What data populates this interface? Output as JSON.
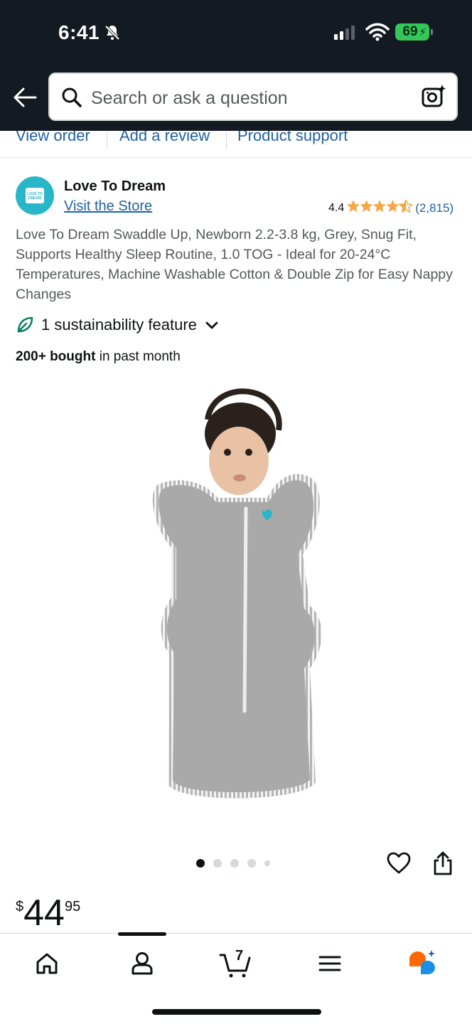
{
  "status_bar": {
    "time": "6:41",
    "battery": "69"
  },
  "search": {
    "placeholder": "Search or ask a question"
  },
  "subnav": {
    "items": [
      "View order",
      "Add a review",
      "Product support"
    ]
  },
  "brand": {
    "name": "Love To Dream",
    "visit_store": "Visit the Store",
    "logo_text": "LOVE TO DREAM"
  },
  "rating": {
    "value": "4.4",
    "stars": 4.4,
    "count": "(2,815)"
  },
  "product": {
    "title": "Love To Dream Swaddle Up, Newborn 2.2-3.8 kg, Grey, Snug Fit, Supports Healthy Sleep Routine, 1.0 TOG - Ideal for 20-24°C Temperatures, Machine Washable Cotton & Double Zip for Easy Nappy Changes",
    "sustainability": "1 sustainability feature",
    "bought_bold": "200+ bought",
    "bought_rest": " in past month",
    "image_count": 5,
    "image_index": 1
  },
  "price": {
    "currency": "$",
    "whole": "44",
    "fraction": "95"
  },
  "bottom_nav": {
    "items": [
      "home-icon",
      "account-icon",
      "cart-icon",
      "menu-icon",
      "rufus-icon"
    ],
    "cart_count": "7"
  },
  "colors": {
    "header_bg": "#131a22",
    "link": "#2162a1",
    "star": "#f3a847",
    "brand": "#29b6c9",
    "leaf": "#067d62"
  }
}
